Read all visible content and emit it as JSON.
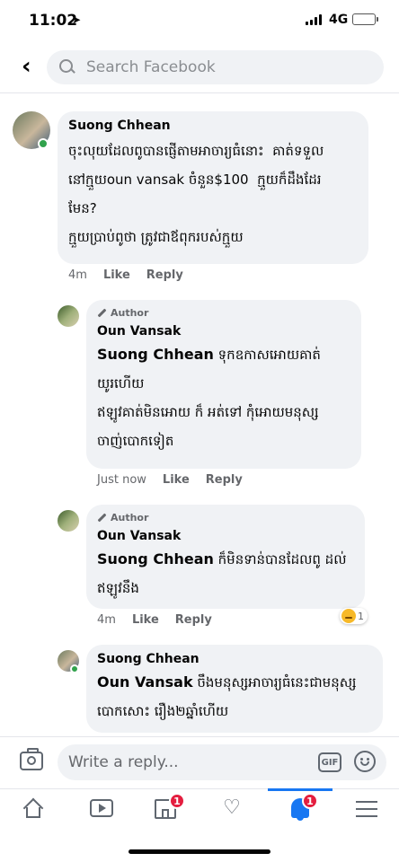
{
  "status_bar": {
    "time": "11:02",
    "network": "4G"
  },
  "header": {
    "search_placeholder": "Search Facebook"
  },
  "comments": [
    {
      "author": "Suong Chhean",
      "text": "ចុះលុយដែលពូបានផ្ញើតាមអាចារ្យធំនោះ  គាត់ទទួល\nនៅក្មួយoun vansak ចំនួន$100  ក្មួយក៏ដឹងដែរ\nមែន?\nក្មួយប្រាប់ពូថា ត្រូវជាឪពុករបស់ក្មួយ",
      "time": "4m",
      "like": "Like",
      "reply": "Reply"
    },
    {
      "badge": "Author",
      "author": "Oun Vansak",
      "mention": "Suong Chhean",
      "text": " ទុកឧកាសអោយគាត់\nយូរហើយ\nឥឡូវគាត់មិនអោយ ក៏ អត់ទៅ កុំអោយមនុស្ស\nចាញ់បោកទៀត",
      "time": "Just now",
      "like": "Like",
      "reply": "Reply"
    },
    {
      "badge": "Author",
      "author": "Oun Vansak",
      "mention": "Suong Chhean",
      "text": " ក៏មិនទាន់បានដែលពូ ដល់\nឥឡូវនឹង",
      "time": "4m",
      "like": "Like",
      "reply": "Reply",
      "reaction_count": "1"
    },
    {
      "author": "Suong Chhean",
      "mention": "Oun Vansak",
      "text": " ចឹងមនុស្សអាចារ្យធំនេះជាមនុស្ស\nបោកសោះ រឿង២ឆ្នាំហើយ"
    }
  ],
  "reply_bar": {
    "placeholder": "Write a reply...",
    "gif_label": "GIF"
  },
  "tab_bar": {
    "marketplace_badge": "1",
    "notifications_badge": "1"
  }
}
